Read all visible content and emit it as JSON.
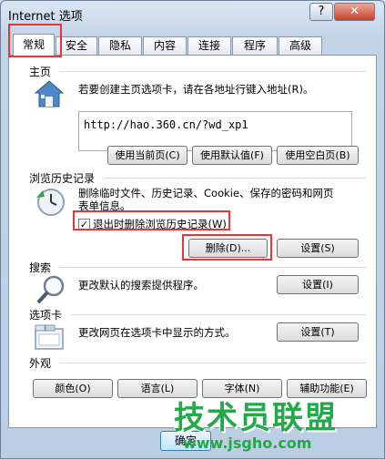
{
  "window": {
    "title": "Internet 选项",
    "help_label": "?",
    "close_label": "✕"
  },
  "tabs": [
    {
      "label": "常规",
      "active": true
    },
    {
      "label": "安全"
    },
    {
      "label": "隐私"
    },
    {
      "label": "内容"
    },
    {
      "label": "连接"
    },
    {
      "label": "程序"
    },
    {
      "label": "高级"
    }
  ],
  "home": {
    "title": "主页",
    "desc": "若要创建主页选项卡，请在各地址行键入地址(R)。",
    "url": "http://hao.360.cn/?wd_xp1",
    "buttons": [
      "使用当前页(C)",
      "使用默认值(F)",
      "使用空白页(B)"
    ],
    "icon": "house-icon"
  },
  "history": {
    "title": "浏览历史记录",
    "desc_line1": "删除临时文件、历史记录、Cookie、保存的密码和网页",
    "desc_line2": "表单信息。",
    "checkbox_label": "退出时删除浏览历史记录(W)",
    "checkbox_mark": "✓",
    "checked": true,
    "delete_label": "删除(D)...",
    "settings_label": "设置(S)",
    "icon": "history-clock-icon"
  },
  "search": {
    "title": "搜索",
    "desc": "更改默认的搜索提供程序。",
    "settings_label": "设置(I)",
    "icon": "magnifier-icon"
  },
  "tabs_section": {
    "title": "选项卡",
    "desc": "更改网页在选项卡中显示的方式。",
    "settings_label": "设置(T)",
    "icon": "tabs-window-icon"
  },
  "appearance": {
    "title": "外观",
    "buttons": [
      "颜色(O)",
      "语言(L)",
      "字体(N)",
      "辅助功能(E)"
    ]
  },
  "footer": {
    "ok_label": "确定"
  },
  "watermark": {
    "text": "技术员联盟",
    "url": "www.jsgho.com"
  },
  "colors": {
    "highlight": "#e33333",
    "watermark": "#23a84a"
  }
}
